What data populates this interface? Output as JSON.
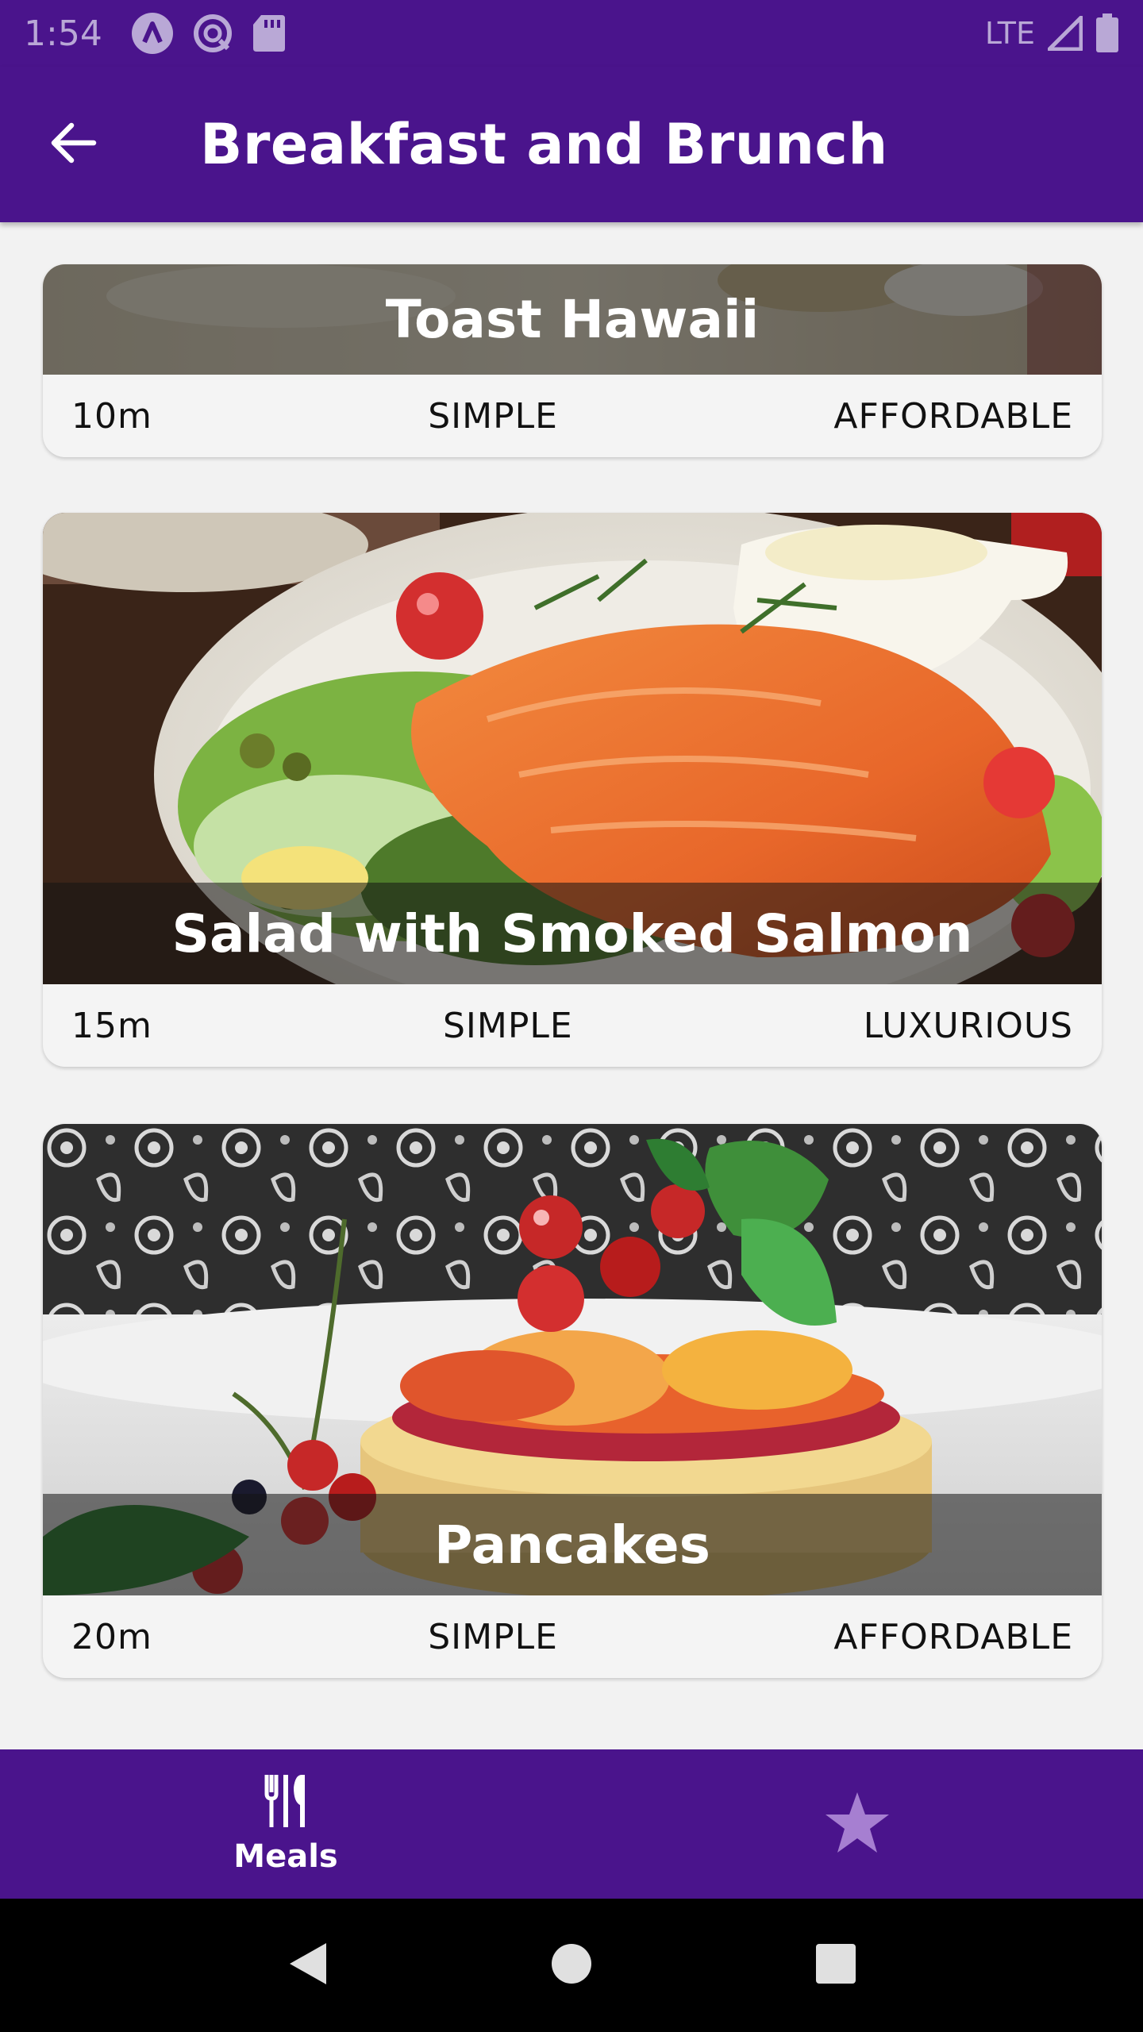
{
  "status_bar": {
    "time": "1:54",
    "network": "LTE",
    "icons": [
      "a-icon",
      "sync-icon",
      "sd-card-icon",
      "signal-icon",
      "battery-icon"
    ]
  },
  "app_bar": {
    "title": "Breakfast and Brunch",
    "back_icon": "arrow-back-icon"
  },
  "meals": [
    {
      "title": "Toast Hawaii",
      "duration": "10m",
      "complexity": "SIMPLE",
      "affordability": "AFFORDABLE"
    },
    {
      "title": "Salad with Smoked Salmon",
      "duration": "15m",
      "complexity": "SIMPLE",
      "affordability": "LUXURIOUS"
    },
    {
      "title": "Pancakes",
      "duration": "20m",
      "complexity": "SIMPLE",
      "affordability": "AFFORDABLE"
    }
  ],
  "bottom_nav": {
    "items": [
      {
        "label": "Meals",
        "icon": "fork-knife-icon",
        "selected": true
      },
      {
        "label": "",
        "icon": "star-icon",
        "selected": false
      }
    ]
  },
  "colors": {
    "primary": "#4a148c",
    "background": "#f2f2f2",
    "inactive_icon": "#a67fd1"
  }
}
